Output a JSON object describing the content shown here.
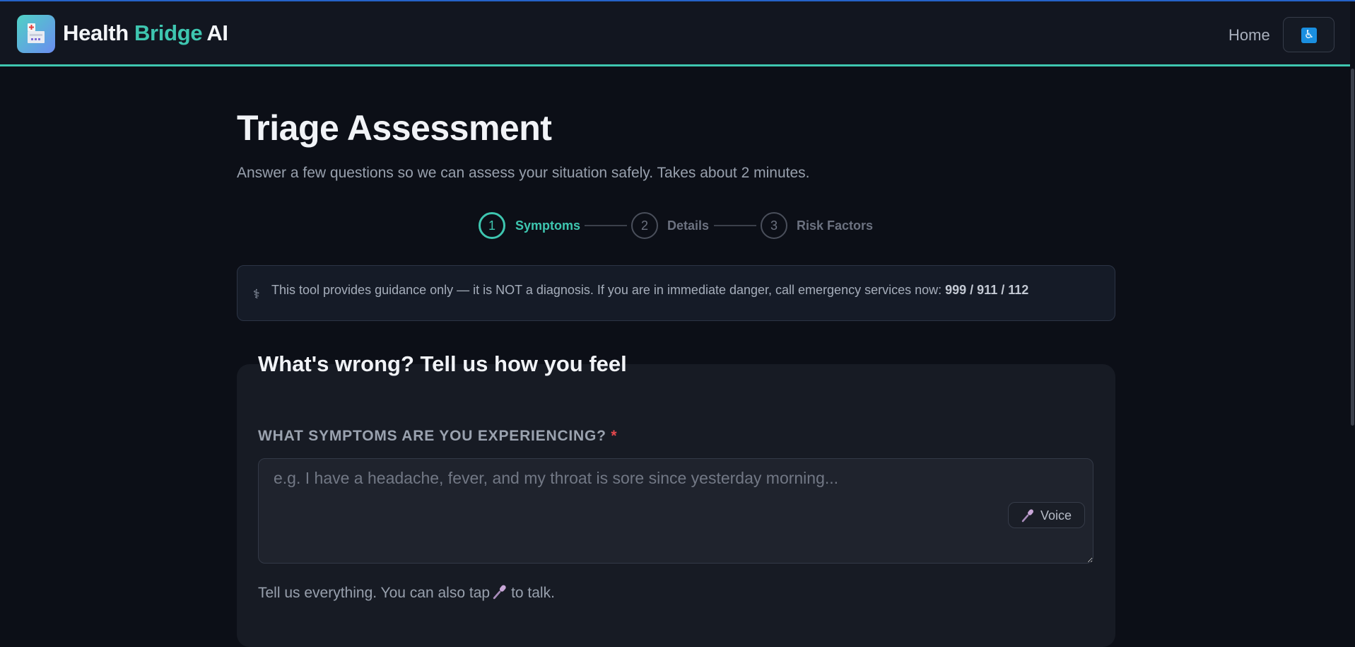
{
  "header": {
    "brand_part1": "Health",
    "brand_part2": "Bridge",
    "brand_part3": "AI",
    "nav_home": "Home",
    "accessibility_icon": "accessibility-icon",
    "accessibility_glyph": "♿"
  },
  "page": {
    "title": "Triage Assessment",
    "subtitle": "Answer a few questions so we can assess your situation safely. Takes about 2 minutes."
  },
  "stepper": {
    "current_step": 1,
    "steps": [
      {
        "number": "1",
        "label": "Symptoms"
      },
      {
        "number": "2",
        "label": "Details"
      },
      {
        "number": "3",
        "label": "Risk Factors"
      }
    ]
  },
  "notice": {
    "icon": "medical-icon",
    "glyph": "⚕",
    "text": "This tool provides guidance only — it is NOT a diagnosis. If you are in immediate danger, call emergency services now: ",
    "emergency_numbers": "999 / 911 / 112"
  },
  "form": {
    "section_title": "What's wrong? Tell us how you feel",
    "symptoms_label": "WHAT SYMPTOMS ARE YOU EXPERIENCING?",
    "required_marker": "*",
    "symptoms_value": "",
    "symptoms_placeholder": "e.g. I have a headache, fever, and my throat is sore since yesterday morning...",
    "voice_button_label": "Voice",
    "voice_icon": "microphone-icon",
    "helper_before": "Tell us everything. You can also tap",
    "helper_after": "to talk."
  },
  "colors": {
    "accent": "#3ec6b0",
    "background": "#0c0f17",
    "required": "#e5484d"
  }
}
